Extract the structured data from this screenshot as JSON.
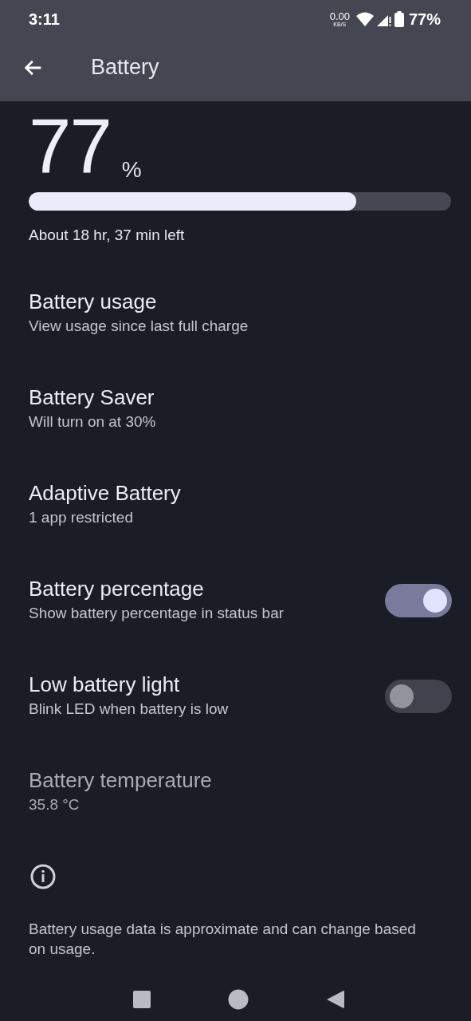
{
  "status_bar": {
    "time": "3:11",
    "net_speed": "0.00",
    "net_unit": "KB/S",
    "battery": "77%"
  },
  "app_bar": {
    "title": "Battery"
  },
  "battery_level": {
    "value": "77",
    "unit": "%",
    "level": 0.775,
    "time_left": "About 18 hr, 37 min left"
  },
  "items": [
    {
      "kind": "link",
      "title": "Battery usage",
      "summary": "View usage since last full charge",
      "disabled": false
    },
    {
      "kind": "link",
      "title": "Battery Saver",
      "summary": "Will turn on at 30%",
      "disabled": false
    },
    {
      "kind": "link",
      "title": "Adaptive Battery",
      "summary": "1 app restricted",
      "disabled": false
    },
    {
      "kind": "switch",
      "title": "Battery percentage",
      "summary": "Show battery percentage in status bar",
      "on": true,
      "disabled": false
    },
    {
      "kind": "switch",
      "title": "Low battery light",
      "summary": "Blink LED when battery is low",
      "on": false,
      "disabled": false
    },
    {
      "kind": "link",
      "title": "Battery temperature",
      "summary": "35.8 °C",
      "disabled": true
    }
  ],
  "footer": {
    "text": "Battery usage data is approximate and can change based on usage."
  }
}
